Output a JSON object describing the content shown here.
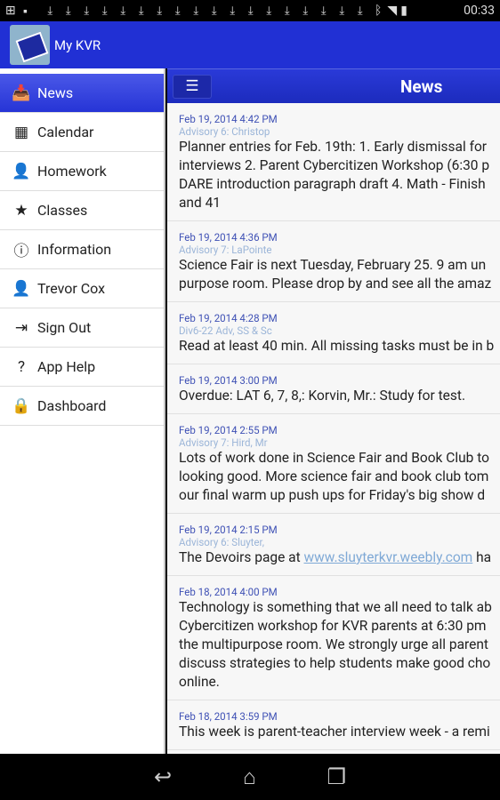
{
  "status": {
    "time": "00:33",
    "download_count": 18
  },
  "app": {
    "title": "My KVR"
  },
  "sidebar": {
    "items": [
      {
        "label": "News",
        "icon": "inbox-icon",
        "glyph": "📥",
        "active": true
      },
      {
        "label": "Calendar",
        "icon": "calendar-icon",
        "glyph": "▦"
      },
      {
        "label": "Homework",
        "icon": "user-list-icon",
        "glyph": "👤"
      },
      {
        "label": "Classes",
        "icon": "star-icon",
        "glyph": "★"
      },
      {
        "label": "Information",
        "icon": "info-icon",
        "glyph": "ⓘ"
      },
      {
        "label": "Trevor Cox",
        "icon": "user-icon",
        "glyph": "👤"
      },
      {
        "label": "Sign Out",
        "icon": "sign-out-icon",
        "glyph": "⇥"
      },
      {
        "label": "App Help",
        "icon": "question-icon",
        "glyph": "?"
      },
      {
        "label": "Dashboard",
        "icon": "lock-icon",
        "glyph": "🔒"
      }
    ]
  },
  "main": {
    "title": "News",
    "items": [
      {
        "date": "Feb 19, 2014 4:42 PM",
        "source": "Advisory 6: Christop",
        "lines": [
          "Planner entries for Feb. 19th: 1. Early dismissal for",
          "interviews 2. Parent Cybercitizen Workshop (6:30 p",
          "DARE introduction paragraph draft 4. Math - Finish",
          "and 41"
        ]
      },
      {
        "date": "Feb 19, 2014 4:36 PM",
        "source": "Advisory 7: LaPointe",
        "lines": [
          "Science Fair is next Tuesday, February 25. 9 am un",
          "purpose room. Please drop by and see all the amaz"
        ]
      },
      {
        "date": "Feb 19, 2014 4:28 PM",
        "source": "Div6-22 Adv, SS & Sc",
        "lines": [
          "Read at least 40 min. All missing tasks must be in b"
        ]
      },
      {
        "date": "Feb 19, 2014 3:00 PM",
        "source": "",
        "lines": [
          "Overdue: LAT 6, 7, 8,: Korvin, Mr.: Study for test."
        ]
      },
      {
        "date": "Feb 19, 2014 2:55 PM",
        "source": "Advisory 7: Hird, Mr",
        "lines": [
          "Lots of work done in Science Fair and Book Club to",
          "looking good. More science fair and book club tom",
          "our final warm up push ups for Friday's big show d"
        ]
      },
      {
        "date": "Feb 19, 2014 2:15 PM",
        "source": "Advisory 6: Sluyter,",
        "lines": [],
        "link_line": {
          "before": "The Devoirs page at ",
          "link": "www.sluyterkvr.weebly.com",
          "after": " ha"
        }
      },
      {
        "date": "Feb 18, 2014 4:00 PM",
        "source": "",
        "lines": [
          "Technology is something that we all need to talk ab",
          "Cybercitizen workshop for KVR parents at 6:30 pm",
          "the multipurpose room. We strongly urge all parent",
          "discuss strategies to help students make good cho",
          "online."
        ]
      },
      {
        "date": "Feb 18, 2014 3:59 PM",
        "source": "",
        "lines": [
          "This week is parent-teacher interview week - a remi"
        ]
      }
    ]
  }
}
